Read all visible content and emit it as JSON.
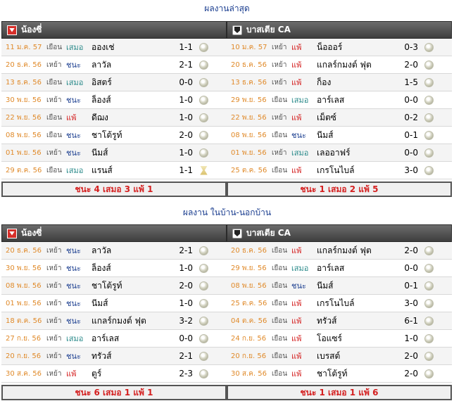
{
  "recent": {
    "title": "ผลงานล่าสุด",
    "left": {
      "team": "น้องซี่",
      "summary": "ชนะ 4 เสมอ 3 แพ้ 1",
      "rows": [
        {
          "date": "11 ม.ค. 57",
          "venue": "เยือน",
          "result": "เสมอ",
          "opponent": "อองเช่",
          "score": "1-1",
          "icon": "ball"
        },
        {
          "date": "20 ธ.ค. 56",
          "venue": "เหย้า",
          "result": "ชนะ",
          "opponent": "ลาวัล",
          "score": "2-1",
          "icon": "ball"
        },
        {
          "date": "13 ธ.ค. 56",
          "venue": "เยือน",
          "result": "เสมอ",
          "opponent": "อิสตร์",
          "score": "0-0",
          "icon": "ball"
        },
        {
          "date": "30 พ.ย. 56",
          "venue": "เหย้า",
          "result": "ชนะ",
          "opponent": "ล็องส์",
          "score": "1-0",
          "icon": "ball"
        },
        {
          "date": "22 พ.ย. 56",
          "venue": "เยือน",
          "result": "แพ้",
          "opponent": "ดีฌง",
          "score": "1-0",
          "icon": "ball"
        },
        {
          "date": "08 พ.ย. 56",
          "venue": "เยือน",
          "result": "ชนะ",
          "opponent": "ชาโต้รูท์",
          "score": "2-0",
          "icon": "ball"
        },
        {
          "date": "01 พ.ย. 56",
          "venue": "เหย้า",
          "result": "ชนะ",
          "opponent": "นีมส์",
          "score": "1-0",
          "icon": "ball"
        },
        {
          "date": "29 ต.ค. 56",
          "venue": "เยือน",
          "result": "เสมอ",
          "opponent": "แรนส์",
          "score": "1-1",
          "icon": "hourglass"
        }
      ]
    },
    "right": {
      "team": "บาสเตีย CA",
      "summary": "ชนะ 1 เสมอ 2 แพ้ 5",
      "rows": [
        {
          "date": "10 ม.ค. 57",
          "venue": "เหย้า",
          "result": "แพ้",
          "opponent": "น็อออร์",
          "score": "0-3",
          "icon": "ball"
        },
        {
          "date": "20 ธ.ค. 56",
          "venue": "เหย้า",
          "result": "แพ้",
          "opponent": "แกลร์กมงต์ ฟุต",
          "score": "2-0",
          "icon": "ball"
        },
        {
          "date": "13 ธ.ค. 56",
          "venue": "เหย้า",
          "result": "แพ้",
          "opponent": "ก็อง",
          "score": "1-5",
          "icon": "ball"
        },
        {
          "date": "29 พ.ย. 56",
          "venue": "เยือน",
          "result": "เสมอ",
          "opponent": "อาร์เลส",
          "score": "0-0",
          "icon": "ball"
        },
        {
          "date": "22 พ.ย. 56",
          "venue": "เหย้า",
          "result": "แพ้",
          "opponent": "เม็ตซ์",
          "score": "0-2",
          "icon": "ball"
        },
        {
          "date": "08 พ.ย. 56",
          "venue": "เยือน",
          "result": "ชนะ",
          "opponent": "นีมส์",
          "score": "0-1",
          "icon": "ball"
        },
        {
          "date": "01 พ.ย. 56",
          "venue": "เหย้า",
          "result": "เสมอ",
          "opponent": "เลออาฟร์",
          "score": "0-0",
          "icon": "ball"
        },
        {
          "date": "25 ต.ค. 56",
          "venue": "เยือน",
          "result": "แพ้",
          "opponent": "เกรโนไบล์",
          "score": "3-0",
          "icon": "ball"
        }
      ]
    }
  },
  "homeaway": {
    "title": "ผลงาน ในบ้าน-นอกบ้าน",
    "left": {
      "team": "น้องซี่",
      "summary": "ชนะ 6 เสมอ 1 แพ้ 1",
      "rows": [
        {
          "date": "20 ธ.ค. 56",
          "venue": "เหย้า",
          "result": "ชนะ",
          "opponent": "ลาวัล",
          "score": "2-1",
          "icon": "ball"
        },
        {
          "date": "30 พ.ย. 56",
          "venue": "เหย้า",
          "result": "ชนะ",
          "opponent": "ล็องส์",
          "score": "1-0",
          "icon": "ball"
        },
        {
          "date": "08 พ.ย. 56",
          "venue": "เหย้า",
          "result": "ชนะ",
          "opponent": "ชาโต้รูท์",
          "score": "2-0",
          "icon": "ball"
        },
        {
          "date": "01 พ.ย. 56",
          "venue": "เหย้า",
          "result": "ชนะ",
          "opponent": "นีมส์",
          "score": "1-0",
          "icon": "ball"
        },
        {
          "date": "18 ต.ค. 56",
          "venue": "เหย้า",
          "result": "ชนะ",
          "opponent": "แกลร์กมงต์ ฟุต",
          "score": "3-2",
          "icon": "ball"
        },
        {
          "date": "27 ก.ย. 56",
          "venue": "เหย้า",
          "result": "เสมอ",
          "opponent": "อาร์เลส",
          "score": "0-0",
          "icon": "ball"
        },
        {
          "date": "20 ก.ย. 56",
          "venue": "เหย้า",
          "result": "ชนะ",
          "opponent": "ทรัวส์",
          "score": "2-1",
          "icon": "ball"
        },
        {
          "date": "30 ส.ค. 56",
          "venue": "เหย้า",
          "result": "แพ้",
          "opponent": "ตูร์",
          "score": "2-3",
          "icon": "ball"
        }
      ]
    },
    "right": {
      "team": "บาสเตีย CA",
      "summary": "ชนะ 1 เสมอ 1 แพ้ 6",
      "rows": [
        {
          "date": "20 ธ.ค. 56",
          "venue": "เยือน",
          "result": "แพ้",
          "opponent": "แกลร์กมงต์ ฟุต",
          "score": "2-0",
          "icon": "ball"
        },
        {
          "date": "29 พ.ย. 56",
          "venue": "เยือน",
          "result": "เสมอ",
          "opponent": "อาร์เลส",
          "score": "0-0",
          "icon": "ball"
        },
        {
          "date": "08 พ.ย. 56",
          "venue": "เยือน",
          "result": "ชนะ",
          "opponent": "นีมส์",
          "score": "0-1",
          "icon": "ball"
        },
        {
          "date": "25 ต.ค. 56",
          "venue": "เยือน",
          "result": "แพ้",
          "opponent": "เกรโนไบล์",
          "score": "3-0",
          "icon": "ball"
        },
        {
          "date": "04 ต.ค. 56",
          "venue": "เยือน",
          "result": "แพ้",
          "opponent": "ทรัวส์",
          "score": "6-1",
          "icon": "ball"
        },
        {
          "date": "24 ก.ย. 56",
          "venue": "เยือน",
          "result": "แพ้",
          "opponent": "โอแซร์",
          "score": "1-0",
          "icon": "ball"
        },
        {
          "date": "20 ก.ย. 56",
          "venue": "เยือน",
          "result": "แพ้",
          "opponent": "เบรสต์",
          "score": "2-0",
          "icon": "ball"
        },
        {
          "date": "30 ส.ค. 56",
          "venue": "เยือน",
          "result": "แพ้",
          "opponent": "ชาโต้รูท์",
          "score": "2-0",
          "icon": "ball"
        }
      ]
    }
  },
  "colors": {
    "win": "#1a3d8f",
    "draw": "#2a8a8a",
    "loss": "#d42020",
    "date": "#e08a2a",
    "header": "#4a4a4a"
  }
}
